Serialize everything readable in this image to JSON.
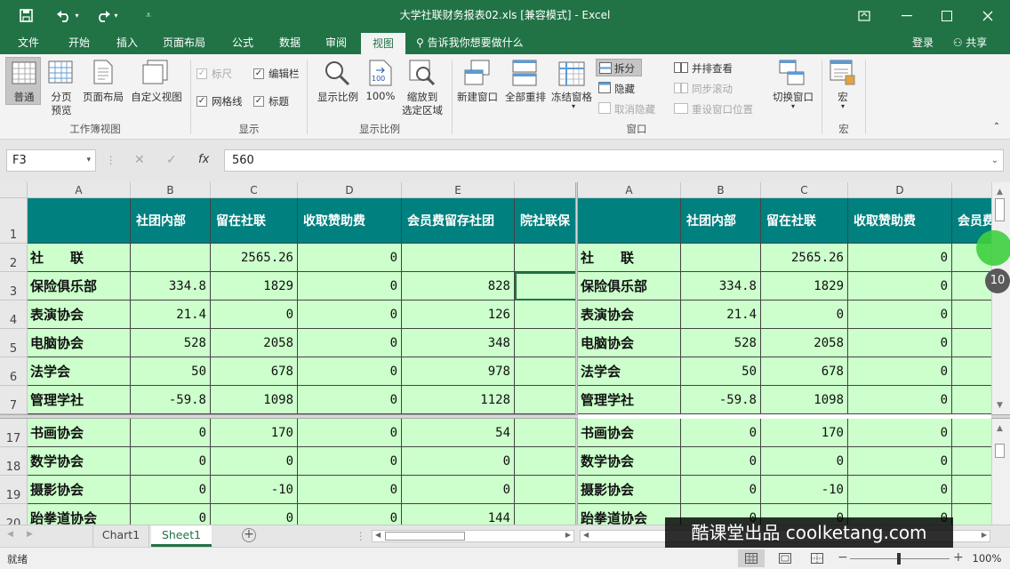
{
  "window": {
    "title": "大学社联财务报表02.xls  [兼容模式] - Excel",
    "save_icon": "save-icon",
    "undo_icon": "undo-icon",
    "redo_icon": "redo-icon"
  },
  "tabs": [
    {
      "label": "文件"
    },
    {
      "label": "开始"
    },
    {
      "label": "插入"
    },
    {
      "label": "页面布局"
    },
    {
      "label": "公式"
    },
    {
      "label": "数据"
    },
    {
      "label": "审阅"
    },
    {
      "label": "视图"
    }
  ],
  "tell_me": "告诉我你想要做什么",
  "login": "登录",
  "share": "共享",
  "ribbon": {
    "workbook_views": {
      "normal": "普通",
      "page_break_1": "分页",
      "page_break_2": "预览",
      "page_layout": "页面布局",
      "custom_views": "自定义视图",
      "group": "工作簿视图"
    },
    "show": {
      "ruler": "标尺",
      "formula_bar": "编辑栏",
      "gridlines": "网格线",
      "headings": "标题",
      "group": "显示"
    },
    "zoom": {
      "zoom": "显示比例",
      "hundred": "100%",
      "zoom_sel_1": "缩放到",
      "zoom_sel_2": "选定区域",
      "group": "显示比例"
    },
    "window": {
      "new_window": "新建窗口",
      "arrange_all": "全部重排",
      "freeze_panes": "冻结窗格",
      "split": "拆分",
      "hide": "隐藏",
      "unhide": "取消隐藏",
      "side_by_side": "并排查看",
      "sync_scroll": "同步滚动",
      "reset_pos": "重设窗口位置",
      "switch": "切换窗口",
      "group": "窗口"
    },
    "macros": {
      "macros": "宏",
      "group": "宏"
    }
  },
  "formula_bar": {
    "name_box": "F3",
    "formula": "560",
    "fx": "fx"
  },
  "columns_left": [
    "A",
    "B",
    "C",
    "D",
    "E"
  ],
  "columns_right": [
    "A",
    "B",
    "C",
    "D"
  ],
  "headers_row": [
    "",
    "社团内部",
    "留在社联",
    "收取赞助费",
    "会员费留存社团",
    "院社联保"
  ],
  "headers_row_right": [
    "",
    "社团内部",
    "留在社联",
    "收取赞助费",
    "会员费"
  ],
  "rows_top": [
    {
      "num": "2",
      "cells": [
        "社　　联",
        "",
        "2565.26",
        "0",
        "",
        ""
      ]
    },
    {
      "num": "3",
      "cells": [
        "保险俱乐部",
        "334.8",
        "1829",
        "0",
        "828",
        ""
      ]
    },
    {
      "num": "4",
      "cells": [
        "表演协会",
        "21.4",
        "0",
        "0",
        "126",
        ""
      ]
    },
    {
      "num": "5",
      "cells": [
        "电脑协会",
        "528",
        "2058",
        "0",
        "348",
        ""
      ]
    },
    {
      "num": "6",
      "cells": [
        "法学会",
        "50",
        "678",
        "0",
        "978",
        ""
      ]
    },
    {
      "num": "7",
      "cells": [
        "管理学社",
        "-59.8",
        "1098",
        "0",
        "1128",
        ""
      ]
    }
  ],
  "rows_bottom": [
    {
      "num": "17",
      "cells": [
        "书画协会",
        "0",
        "170",
        "0",
        "54",
        ""
      ]
    },
    {
      "num": "18",
      "cells": [
        "数学协会",
        "0",
        "0",
        "0",
        "0",
        ""
      ]
    },
    {
      "num": "19",
      "cells": [
        "摄影协会",
        "0",
        "-10",
        "0",
        "0",
        ""
      ]
    },
    {
      "num": "20",
      "cells": [
        "跆拳道协会",
        "0",
        "0",
        "0",
        "144",
        ""
      ]
    }
  ],
  "header_row_num": "1",
  "sheets": [
    "Chart1",
    "Sheet1"
  ],
  "status": "就绪",
  "zoom_level": "100%",
  "overlay": {
    "badge": "10",
    "watermark": "酷课堂出品 coolketang.com"
  },
  "colors": {
    "brand": "#217346",
    "header_fill": "#00807f",
    "cell_fill": "#ccffcc"
  }
}
